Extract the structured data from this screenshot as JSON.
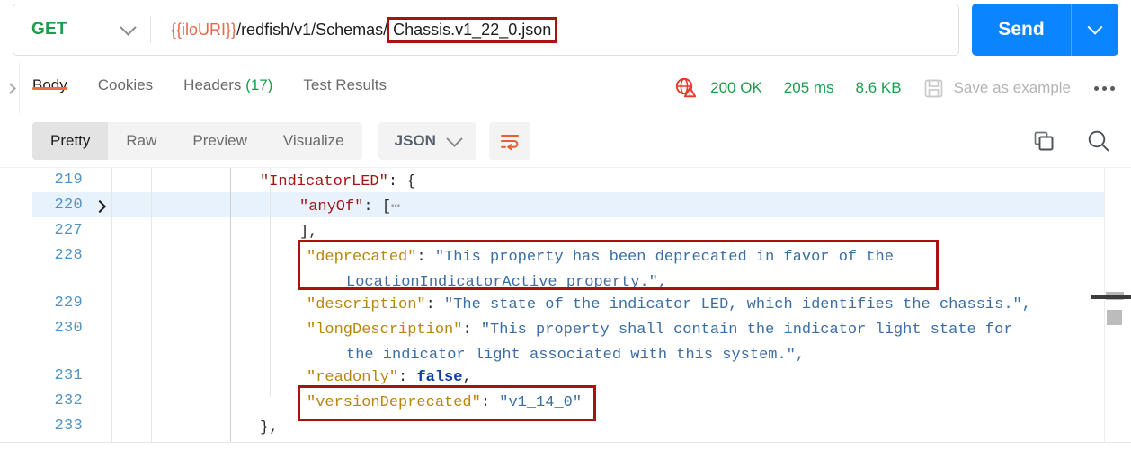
{
  "request": {
    "method": "GET",
    "method_caret_icon": "chevron-down-icon",
    "url_variable": "{{iloURI}}",
    "url_path": "/redfish/v1/Schemas/",
    "url_highlighted": "Chassis.v1_22_0.json",
    "send_label": "Send",
    "send_caret_icon": "chevron-down-icon",
    "highlight_color": "#aa1111"
  },
  "response": {
    "expand_icon": "chevron-right-icon",
    "tabs": [
      {
        "label": "Body",
        "active": true
      },
      {
        "label": "Cookies",
        "active": false
      },
      {
        "label": "Headers (17)",
        "active": false,
        "count": "(17)"
      },
      {
        "label": "Test Results",
        "active": false
      }
    ],
    "status_icon": "globe-warning-icon",
    "status": "200 OK",
    "time": "205 ms",
    "size": "8.6 KB",
    "save_icon": "floppy-disk-icon",
    "save_label": "Save as example",
    "more_icon": "more-horizontal-icon",
    "status_color": "#1a9e4b"
  },
  "viewbar": {
    "modes": [
      {
        "label": "Pretty",
        "active": true
      },
      {
        "label": "Raw",
        "active": false
      },
      {
        "label": "Preview",
        "active": false
      },
      {
        "label": "Visualize",
        "active": false
      }
    ],
    "format": "JSON",
    "format_caret_icon": "chevron-down-icon",
    "wrap_icon": "word-wrap-icon",
    "copy_icon": "copy-icon",
    "search_icon": "search-icon"
  },
  "code": {
    "lines": [
      {
        "num": "219",
        "fold": false,
        "highlight_row": false
      },
      {
        "num": "220",
        "fold": true,
        "highlight_row": true
      },
      {
        "num": "227",
        "fold": false,
        "highlight_row": false
      },
      {
        "num": "228",
        "fold": false,
        "highlight_row": false
      },
      {
        "num": "229",
        "fold": false,
        "highlight_row": false
      },
      {
        "num": "230",
        "fold": false,
        "highlight_row": false
      },
      {
        "num": "231",
        "fold": false,
        "highlight_row": false
      },
      {
        "num": "232",
        "fold": false,
        "highlight_row": false
      },
      {
        "num": "233",
        "fold": false,
        "highlight_row": false
      }
    ],
    "t219_key": "\"IndicatorLED\"",
    "t219_rest": ": {",
    "t220_key": "\"anyOf\"",
    "t220_rest": ": [",
    "t220_elip": "⋯",
    "t227": "],",
    "t228_key": "\"deprecated\"",
    "t228_colon": ": ",
    "t228_val": "\"This property has been deprecated in favor of the",
    "t228b_val": "LocationIndicatorActive property.\",",
    "t229_key": "\"description\"",
    "t229_colon": ": ",
    "t229_val": "\"The state of the indicator LED, which identifies the chassis.\",",
    "t230_key": "\"longDescription\"",
    "t230_colon": ": ",
    "t230_val": "\"This property shall contain the indicator light state for",
    "t230b_val": "the indicator light associated with this system.\",",
    "t231_key": "\"readonly\"",
    "t231_colon": ": ",
    "t231_val": "false",
    "t231_comma": ",",
    "t232_key": "\"versionDeprecated\"",
    "t232_colon": ": ",
    "t232_val": "\"v1_14_0\"",
    "t233": "},"
  },
  "colors": {
    "accent": "#f26b3a",
    "send_blue": "#0a84ff",
    "green": "#1a9e4b",
    "key_red": "#a31515",
    "string_blue": "#3a6ea5",
    "linenum_blue": "#4f94c4",
    "box_red": "#aa1111"
  }
}
